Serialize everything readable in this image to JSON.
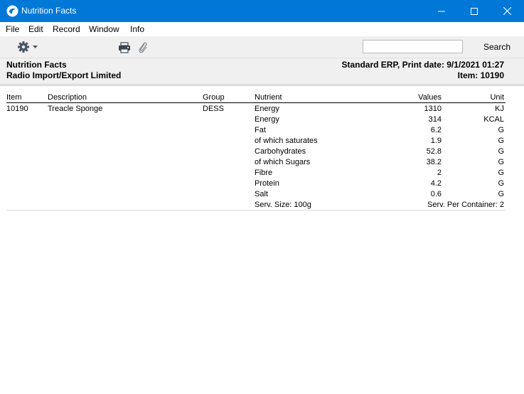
{
  "window": {
    "title": "Nutrition Facts"
  },
  "menu": [
    "File",
    "Edit",
    "Record",
    "Window",
    "Info"
  ],
  "toolbar": {
    "search_placeholder": "",
    "search_label": "Search"
  },
  "report": {
    "title": "Nutrition Facts",
    "company": "Radio Import/Export Limited",
    "print_info": "Standard ERP, Print date: 9/1/2021 01:27",
    "item_label": "Item: 10190"
  },
  "table": {
    "headers": {
      "item": "Item",
      "description": "Description",
      "group": "Group",
      "nutrient": "Nutrient",
      "values": "Values",
      "unit": "Unit"
    },
    "item": {
      "code": "10190",
      "description": "Treacle Sponge",
      "group": "DESS"
    },
    "rows": [
      {
        "nutrient": "Energy",
        "value": "1310",
        "unit": "KJ"
      },
      {
        "nutrient": "Energy",
        "value": "314",
        "unit": "KCAL"
      },
      {
        "nutrient": "Fat",
        "value": "6.2",
        "unit": "G"
      },
      {
        "nutrient": "of which saturates",
        "value": "1.9",
        "unit": "G"
      },
      {
        "nutrient": "Carbohydrates",
        "value": "52.8",
        "unit": "G"
      },
      {
        "nutrient": "of which Sugars",
        "value": "38.2",
        "unit": "G"
      },
      {
        "nutrient": "Fibre",
        "value": "2",
        "unit": "G"
      },
      {
        "nutrient": "Protein",
        "value": "4.2",
        "unit": "G"
      },
      {
        "nutrient": "Salt",
        "value": "0.6",
        "unit": "G"
      }
    ],
    "footer": {
      "serving_size": "Serv. Size: 100g",
      "servings_per_container": "Serv. Per Container: 2"
    }
  },
  "colors": {
    "titlebar": "#0078d7",
    "toolbar": "#f0f0f0",
    "icon_gray": "#6b7280"
  },
  "icons": [
    "app-icon",
    "minimize-icon",
    "maximize-icon",
    "close-icon",
    "gear-icon",
    "chevron-down-icon",
    "printer-icon",
    "paperclip-icon"
  ]
}
